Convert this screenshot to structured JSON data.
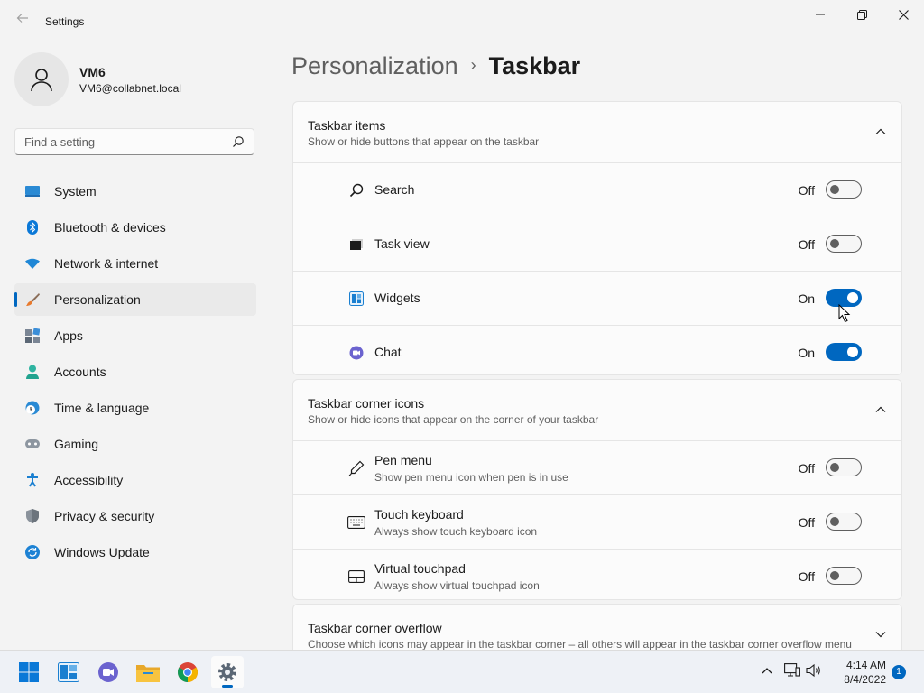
{
  "window": {
    "title": "Settings"
  },
  "user": {
    "name": "VM6",
    "email": "VM6@collabnet.local"
  },
  "search": {
    "placeholder": "Find a setting"
  },
  "sidebar": {
    "items": [
      {
        "label": "System",
        "icon": "system-icon"
      },
      {
        "label": "Bluetooth & devices",
        "icon": "bluetooth-icon"
      },
      {
        "label": "Network & internet",
        "icon": "wifi-icon"
      },
      {
        "label": "Personalization",
        "icon": "brush-icon",
        "active": true
      },
      {
        "label": "Apps",
        "icon": "apps-icon"
      },
      {
        "label": "Accounts",
        "icon": "person-icon"
      },
      {
        "label": "Time & language",
        "icon": "globe-clock-icon"
      },
      {
        "label": "Gaming",
        "icon": "gamepad-icon"
      },
      {
        "label": "Accessibility",
        "icon": "accessibility-icon"
      },
      {
        "label": "Privacy & security",
        "icon": "shield-icon"
      },
      {
        "label": "Windows Update",
        "icon": "update-icon"
      }
    ]
  },
  "breadcrumb": {
    "parent": "Personalization",
    "separator": "›",
    "current": "Taskbar"
  },
  "groups": {
    "taskbar_items": {
      "title": "Taskbar items",
      "subtitle": "Show or hide buttons that appear on the taskbar",
      "rows": [
        {
          "label": "Search",
          "state": "Off",
          "icon": "search-icon"
        },
        {
          "label": "Task view",
          "state": "Off",
          "icon": "task-view-icon"
        },
        {
          "label": "Widgets",
          "state": "On",
          "icon": "widgets-icon"
        },
        {
          "label": "Chat",
          "state": "On",
          "icon": "chat-icon"
        }
      ]
    },
    "corner_icons": {
      "title": "Taskbar corner icons",
      "subtitle": "Show or hide icons that appear on the corner of your taskbar",
      "rows": [
        {
          "label": "Pen menu",
          "sub": "Show pen menu icon when pen is in use",
          "state": "Off",
          "icon": "pen-icon"
        },
        {
          "label": "Touch keyboard",
          "sub": "Always show touch keyboard icon",
          "state": "Off",
          "icon": "keyboard-icon"
        },
        {
          "label": "Virtual touchpad",
          "sub": "Always show virtual touchpad icon",
          "state": "Off",
          "icon": "touchpad-icon"
        }
      ]
    },
    "corner_overflow": {
      "title": "Taskbar corner overflow",
      "subtitle": "Choose which icons may appear in the taskbar corner – all others will appear in the taskbar corner overflow menu"
    }
  },
  "taskbar": {
    "apps": [
      "start-icon",
      "widgets-icon",
      "chat-icon",
      "file-explorer-icon",
      "chrome-icon",
      "settings-icon"
    ],
    "time": "4:14 AM",
    "date": "8/4/2022",
    "notifications": "1"
  },
  "colors": {
    "accent": "#0067c0",
    "background": "#f3f3f3",
    "card": "#fbfbfb"
  }
}
